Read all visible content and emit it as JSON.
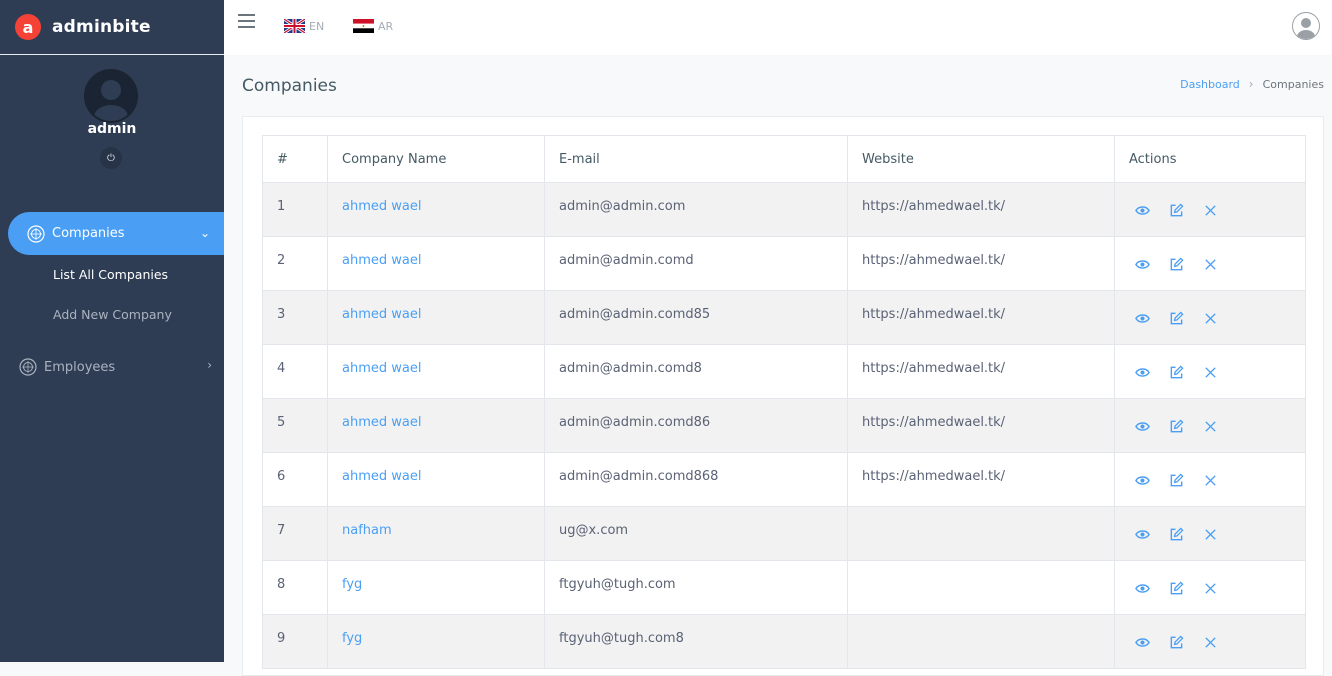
{
  "brand": {
    "logo_letter": "a",
    "name": "adminbite",
    "accent": "#4a9ff5",
    "logo_color": "#f44336"
  },
  "profile": {
    "name": "admin",
    "power_icon": "power-icon"
  },
  "sidebar": {
    "active_item": {
      "label": "Companies",
      "icon": "companies-icon"
    },
    "sub_items": [
      {
        "label": "List All Companies"
      },
      {
        "label": "Add New Company"
      }
    ],
    "item2": {
      "label": "Employees",
      "icon": "employees-icon"
    }
  },
  "topbar": {
    "languages": [
      {
        "code": "EN",
        "flag": "uk-flag"
      },
      {
        "code": "AR",
        "flag": "egypt-flag"
      }
    ]
  },
  "page": {
    "title": "Companies"
  },
  "breadcrumb": {
    "parent": "Dashboard",
    "current": "Companies"
  },
  "table": {
    "headers": [
      "#",
      "Company Name",
      "E-mail",
      "Website",
      "Actions"
    ],
    "rows": [
      {
        "num": "1",
        "name": "ahmed wael",
        "email": "admin@admin.com",
        "website": "https://ahmedwael.tk/"
      },
      {
        "num": "2",
        "name": "ahmed wael",
        "email": "admin@admin.comd",
        "website": "https://ahmedwael.tk/"
      },
      {
        "num": "3",
        "name": "ahmed wael",
        "email": "admin@admin.comd85",
        "website": "https://ahmedwael.tk/"
      },
      {
        "num": "4",
        "name": "ahmed wael",
        "email": "admin@admin.comd8",
        "website": "https://ahmedwael.tk/"
      },
      {
        "num": "5",
        "name": "ahmed wael",
        "email": "admin@admin.comd86",
        "website": "https://ahmedwael.tk/"
      },
      {
        "num": "6",
        "name": "ahmed wael",
        "email": "admin@admin.comd868",
        "website": "https://ahmedwael.tk/"
      },
      {
        "num": "7",
        "name": "nafham",
        "email": "ug@x.com",
        "website": ""
      },
      {
        "num": "8",
        "name": "fyg",
        "email": "ftgyuh@tugh.com",
        "website": ""
      },
      {
        "num": "9",
        "name": "fyg",
        "email": "ftgyuh@tugh.com8",
        "website": ""
      }
    ]
  }
}
